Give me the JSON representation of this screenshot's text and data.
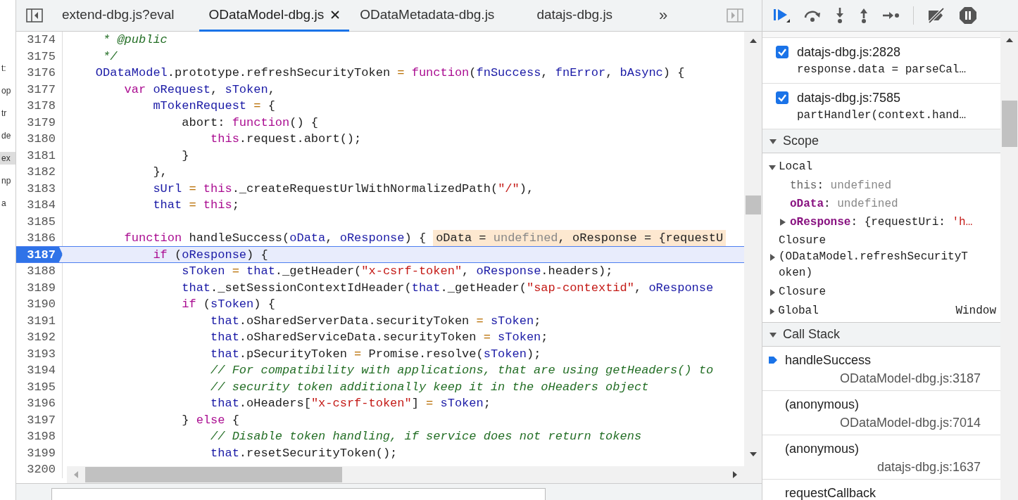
{
  "navigator_fragments": [
    {
      "text": "t:",
      "selected": false
    },
    {
      "text": "op",
      "selected": false
    },
    {
      "text": "tr",
      "selected": false
    },
    {
      "text": "de",
      "selected": false
    },
    {
      "text": "ex",
      "selected": true
    },
    {
      "text": "np",
      "selected": false
    },
    {
      "text": "a",
      "selected": false
    }
  ],
  "tabs": [
    {
      "label": "extend-dbg.js?eval",
      "selected": false,
      "closable": false
    },
    {
      "label": "ODataModel-dbg.js",
      "selected": true,
      "closable": true
    },
    {
      "label": "ODataMetadata-dbg.js",
      "selected": false,
      "closable": false
    },
    {
      "label": "datajs-dbg.js",
      "selected": false,
      "closable": false
    }
  ],
  "more_tabs": "»",
  "code_lines": [
    {
      "number": "3174",
      "current": false,
      "tokens": [
        {
          "text": "     * @public",
          "kind": "comment"
        }
      ]
    },
    {
      "number": "3175",
      "current": false,
      "tokens": [
        {
          "text": "     */",
          "kind": "comment"
        }
      ]
    },
    {
      "number": "3176",
      "current": false,
      "tokens": [
        {
          "text": "    ODataModel",
          "kind": "ident"
        },
        {
          "text": ".prototype.refreshSecurityToken ",
          "kind": "plain"
        },
        {
          "text": "= ",
          "kind": "op"
        },
        {
          "text": "function",
          "kind": "keyword"
        },
        {
          "text": "(",
          "kind": "plain"
        },
        {
          "text": "fnSuccess",
          "kind": "ident"
        },
        {
          "text": ", ",
          "kind": "plain"
        },
        {
          "text": "fnError",
          "kind": "ident"
        },
        {
          "text": ", ",
          "kind": "plain"
        },
        {
          "text": "bAsync",
          "kind": "ident"
        },
        {
          "text": ") {",
          "kind": "plain"
        }
      ]
    },
    {
      "number": "3177",
      "current": false,
      "tokens": [
        {
          "text": "        var ",
          "kind": "keyword"
        },
        {
          "text": "oRequest",
          "kind": "ident"
        },
        {
          "text": ", ",
          "kind": "plain"
        },
        {
          "text": "sToken",
          "kind": "ident"
        },
        {
          "text": ",",
          "kind": "plain"
        }
      ]
    },
    {
      "number": "3178",
      "current": false,
      "tokens": [
        {
          "text": "            mTokenRequest ",
          "kind": "ident"
        },
        {
          "text": "=",
          "kind": "op"
        },
        {
          "text": " {",
          "kind": "plain"
        }
      ]
    },
    {
      "number": "3179",
      "current": false,
      "tokens": [
        {
          "text": "                abort: ",
          "kind": "plain"
        },
        {
          "text": "function",
          "kind": "keyword"
        },
        {
          "text": "() {",
          "kind": "plain"
        }
      ]
    },
    {
      "number": "3180",
      "current": false,
      "tokens": [
        {
          "text": "                    this",
          "kind": "keyword"
        },
        {
          "text": ".request.abort();",
          "kind": "plain"
        }
      ]
    },
    {
      "number": "3181",
      "current": false,
      "tokens": [
        {
          "text": "                }",
          "kind": "plain"
        }
      ]
    },
    {
      "number": "3182",
      "current": false,
      "tokens": [
        {
          "text": "            },",
          "kind": "plain"
        }
      ]
    },
    {
      "number": "3183",
      "current": false,
      "tokens": [
        {
          "text": "            sUrl ",
          "kind": "ident"
        },
        {
          "text": "= ",
          "kind": "op"
        },
        {
          "text": "this",
          "kind": "keyword"
        },
        {
          "text": "._createRequestUrlWithNormalizedPath(",
          "kind": "plain"
        },
        {
          "text": "\"/\"",
          "kind": "string"
        },
        {
          "text": "),",
          "kind": "plain"
        }
      ]
    },
    {
      "number": "3184",
      "current": false,
      "tokens": [
        {
          "text": "            that ",
          "kind": "ident"
        },
        {
          "text": "= ",
          "kind": "op"
        },
        {
          "text": "this",
          "kind": "keyword"
        },
        {
          "text": ";",
          "kind": "plain"
        }
      ]
    },
    {
      "number": "3185",
      "current": false
    },
    {
      "number": "3186",
      "current": false,
      "tokens": [
        {
          "text": "        function",
          "kind": "keyword"
        },
        {
          "text": " handleSuccess(",
          "kind": "plain"
        },
        {
          "text": "oData",
          "kind": "ident"
        },
        {
          "text": ", ",
          "kind": "plain"
        },
        {
          "text": "oResponse",
          "kind": "ident"
        },
        {
          "text": ") {",
          "kind": "plain"
        }
      ],
      "inline_value": [
        {
          "text": "oData = ",
          "kind": "plain"
        },
        {
          "text": "undefined",
          "kind": "undef"
        },
        {
          "text": ", oResponse = {requestU",
          "kind": "plain"
        }
      ]
    },
    {
      "number": "3187",
      "current": true,
      "tokens": [
        {
          "text": "            if",
          "kind": "keyword"
        },
        {
          "text": " (",
          "kind": "plain"
        },
        {
          "text": "oResponse",
          "kind": "ident"
        },
        {
          "text": ") {",
          "kind": "plain"
        }
      ]
    },
    {
      "number": "3188",
      "current": false,
      "tokens": [
        {
          "text": "                sToken ",
          "kind": "ident"
        },
        {
          "text": "= ",
          "kind": "op"
        },
        {
          "text": "that",
          "kind": "ident"
        },
        {
          "text": "._getHeader(",
          "kind": "plain"
        },
        {
          "text": "\"x-csrf-token\"",
          "kind": "string"
        },
        {
          "text": ", ",
          "kind": "plain"
        },
        {
          "text": "oResponse",
          "kind": "ident"
        },
        {
          "text": ".headers);",
          "kind": "plain"
        }
      ]
    },
    {
      "number": "3189",
      "current": false,
      "tokens": [
        {
          "text": "                that",
          "kind": "ident"
        },
        {
          "text": "._setSessionContextIdHeader(",
          "kind": "plain"
        },
        {
          "text": "that",
          "kind": "ident"
        },
        {
          "text": "._getHeader(",
          "kind": "plain"
        },
        {
          "text": "\"sap-contextid\"",
          "kind": "string"
        },
        {
          "text": ", ",
          "kind": "plain"
        },
        {
          "text": "oResponse",
          "kind": "ident"
        }
      ]
    },
    {
      "number": "3190",
      "current": false,
      "tokens": [
        {
          "text": "                if",
          "kind": "keyword"
        },
        {
          "text": " (",
          "kind": "plain"
        },
        {
          "text": "sToken",
          "kind": "ident"
        },
        {
          "text": ") {",
          "kind": "plain"
        }
      ]
    },
    {
      "number": "3191",
      "current": false,
      "tokens": [
        {
          "text": "                    that",
          "kind": "ident"
        },
        {
          "text": ".oSharedServerData.securityToken ",
          "kind": "plain"
        },
        {
          "text": "= ",
          "kind": "op"
        },
        {
          "text": "sToken",
          "kind": "ident"
        },
        {
          "text": ";",
          "kind": "plain"
        }
      ]
    },
    {
      "number": "3192",
      "current": false,
      "tokens": [
        {
          "text": "                    that",
          "kind": "ident"
        },
        {
          "text": ".oSharedServiceData.securityToken ",
          "kind": "plain"
        },
        {
          "text": "= ",
          "kind": "op"
        },
        {
          "text": "sToken",
          "kind": "ident"
        },
        {
          "text": ";",
          "kind": "plain"
        }
      ]
    },
    {
      "number": "3193",
      "current": false,
      "tokens": [
        {
          "text": "                    that",
          "kind": "ident"
        },
        {
          "text": ".pSecurityToken ",
          "kind": "plain"
        },
        {
          "text": "=",
          "kind": "op"
        },
        {
          "text": " Promise.resolve(",
          "kind": "plain"
        },
        {
          "text": "sToken",
          "kind": "ident"
        },
        {
          "text": ");",
          "kind": "plain"
        }
      ]
    },
    {
      "number": "3194",
      "current": false,
      "tokens": [
        {
          "text": "                    // For compatibility with applications, that are using getHeaders() to",
          "kind": "comment"
        }
      ]
    },
    {
      "number": "3195",
      "current": false,
      "tokens": [
        {
          "text": "                    // security token additionally keep it in the oHeaders object",
          "kind": "comment"
        }
      ]
    },
    {
      "number": "3196",
      "current": false,
      "tokens": [
        {
          "text": "                    that",
          "kind": "ident"
        },
        {
          "text": ".oHeaders[",
          "kind": "plain"
        },
        {
          "text": "\"x-csrf-token\"",
          "kind": "string"
        },
        {
          "text": "] ",
          "kind": "plain"
        },
        {
          "text": "= ",
          "kind": "op"
        },
        {
          "text": "sToken",
          "kind": "ident"
        },
        {
          "text": ";",
          "kind": "plain"
        }
      ]
    },
    {
      "number": "3197",
      "current": false,
      "tokens": [
        {
          "text": "                } ",
          "kind": "plain"
        },
        {
          "text": "else",
          "kind": "keyword"
        },
        {
          "text": " {",
          "kind": "plain"
        }
      ]
    },
    {
      "number": "3198",
      "current": false,
      "tokens": [
        {
          "text": "                    // Disable token handling, if service does not return tokens",
          "kind": "comment"
        }
      ]
    },
    {
      "number": "3199",
      "current": false,
      "tokens": [
        {
          "text": "                    that",
          "kind": "ident"
        },
        {
          "text": ".resetSecurityToken();",
          "kind": "plain"
        }
      ]
    },
    {
      "number": "3200",
      "current": false
    }
  ],
  "breakpoints": [
    {
      "checked": true,
      "location": "datajs-dbg.js:2828",
      "code": "response.data = parseCal…"
    },
    {
      "checked": true,
      "location": "datajs-dbg.js:7585",
      "code": "partHandler(context.hand…"
    }
  ],
  "scope": {
    "title": "Scope",
    "expanded": true,
    "groups": [
      {
        "label": "Local",
        "expanded": true,
        "variables": [
          {
            "name": "this",
            "kind": "inherited",
            "expandable": false,
            "value": [
              {
                "text": ": ",
                "kind": "plain"
              },
              {
                "text": "undefined",
                "kind": "undef"
              }
            ]
          },
          {
            "name": "oData",
            "kind": "own",
            "expandable": false,
            "value": [
              {
                "text": ": ",
                "kind": "plain"
              },
              {
                "text": "undefined",
                "kind": "undef"
              }
            ]
          },
          {
            "name": "oResponse",
            "kind": "own",
            "expandable": true,
            "value": [
              {
                "text": ": {requestUri: ",
                "kind": "plain"
              },
              {
                "text": "'h…",
                "kind": "string"
              }
            ]
          }
        ]
      },
      {
        "label": "Closure (ODataModel.refreshSecurityToken)",
        "expanded": false
      },
      {
        "label": "Closure",
        "expanded": false
      },
      {
        "label": "Global",
        "value": "Window",
        "expanded": false
      }
    ]
  },
  "call_stack": {
    "title": "Call Stack",
    "expanded": true,
    "frames": [
      {
        "function": "handleSuccess",
        "location": "ODataModel-dbg.js:3187",
        "selected": true
      },
      {
        "function": "(anonymous)",
        "location": "ODataModel-dbg.js:7014",
        "selected": false
      },
      {
        "function": "(anonymous)",
        "location": "datajs-dbg.js:1637",
        "selected": false
      },
      {
        "function": "requestCallback",
        "selected": false
      }
    ]
  }
}
